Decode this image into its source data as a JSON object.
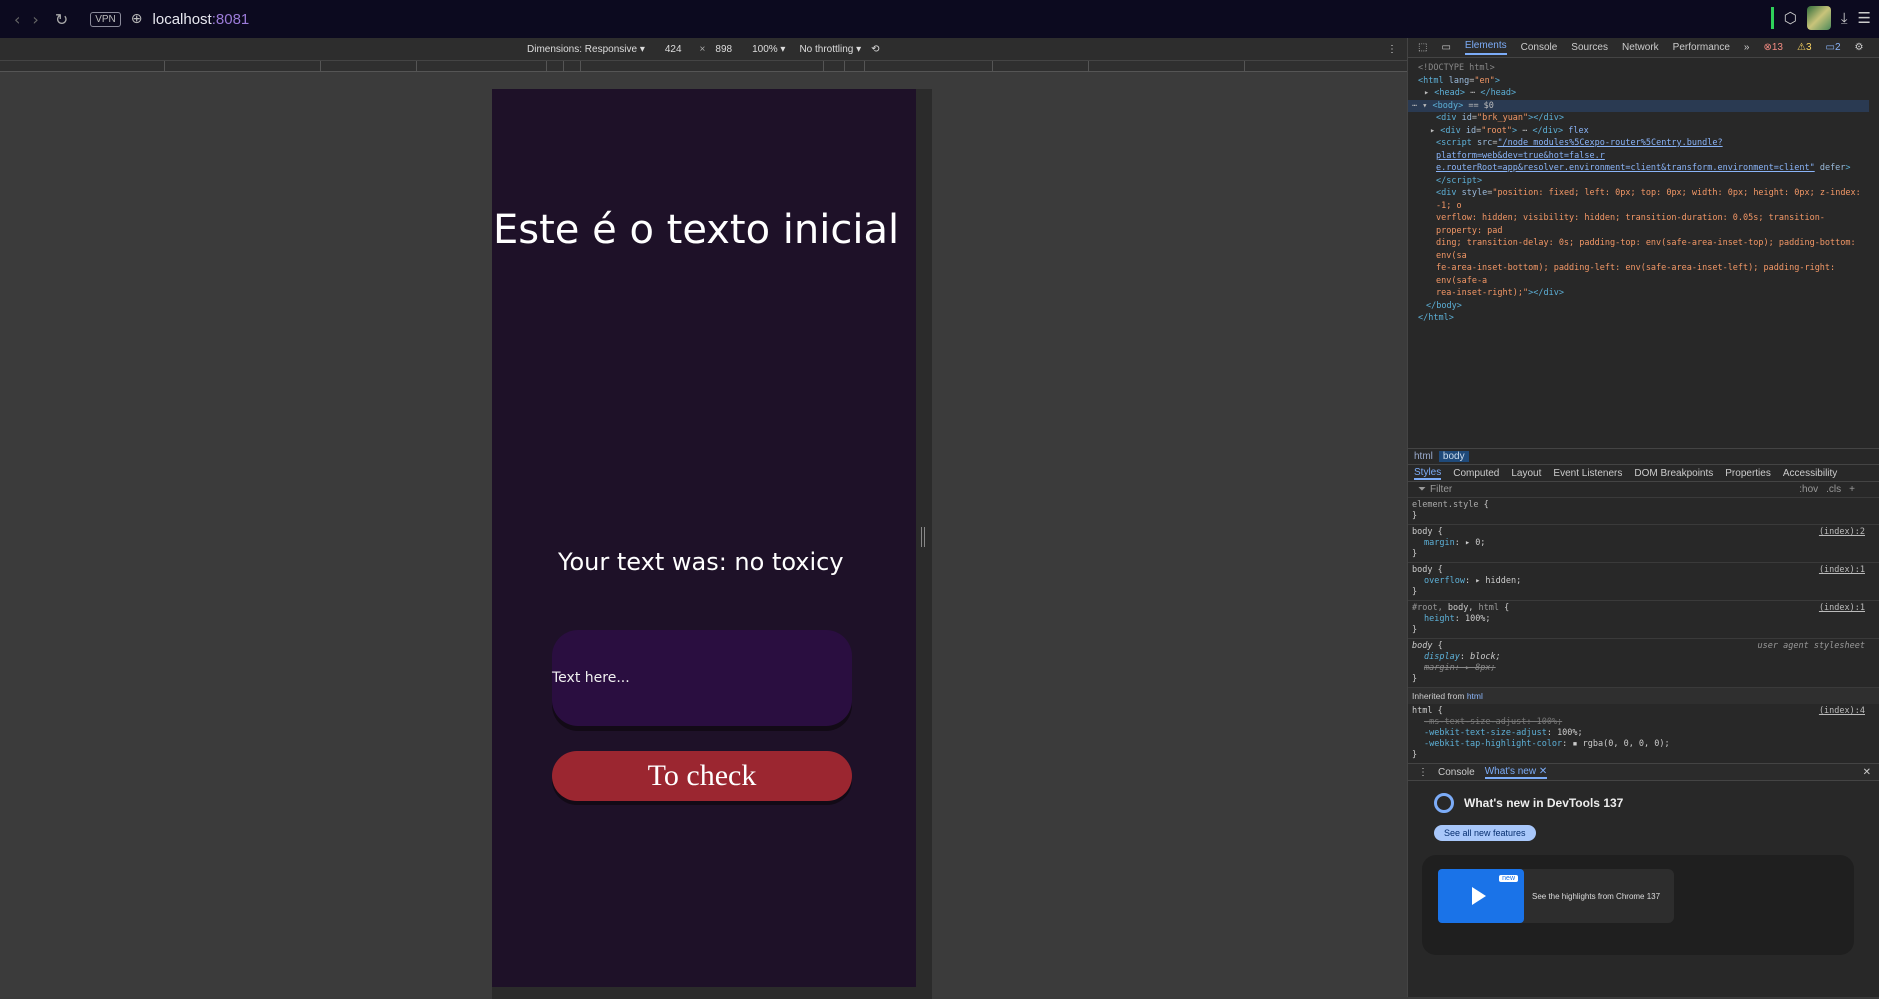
{
  "browser": {
    "vpn_label": "VPN",
    "url_host": "localhost",
    "url_port": ":8081"
  },
  "device_toolbar": {
    "dimensions": "Dimensions: Responsive ▾",
    "width": "424",
    "times": "×",
    "height": "898",
    "zoom": "100% ▾",
    "throttling": "No throttling ▾"
  },
  "app": {
    "initial_text": "Este é o texto inicial",
    "result_text": "Your text was: no toxicy",
    "input_placeholder": "Text here...",
    "check_button": "To check",
    "colors": {
      "background": "#1e1128",
      "input": "#2a0e40",
      "button": "#9b2630"
    }
  },
  "devtools": {
    "tabs": [
      "Elements",
      "Console",
      "Sources",
      "Network",
      "Performance"
    ],
    "errors": "13",
    "warnings": "3",
    "issues": "2",
    "breadcrumbs": [
      "html",
      "body"
    ],
    "style_tabs": [
      "Styles",
      "Computed",
      "Layout",
      "Event Listeners",
      "DOM Breakpoints",
      "Properties",
      "Accessibility"
    ],
    "filter_placeholder": "Filter",
    "filter_hov": ":hov",
    "filter_cls": ".cls",
    "inherited_label": "Inherited from",
    "inherited_from": "html",
    "drawer_tabs": [
      "Console",
      "What's new"
    ],
    "whats_new_title": "What's new in DevTools 137",
    "see_all": "See all new features",
    "highlight_badge": "new",
    "highlight_text": "See the highlights from Chrome 137"
  }
}
